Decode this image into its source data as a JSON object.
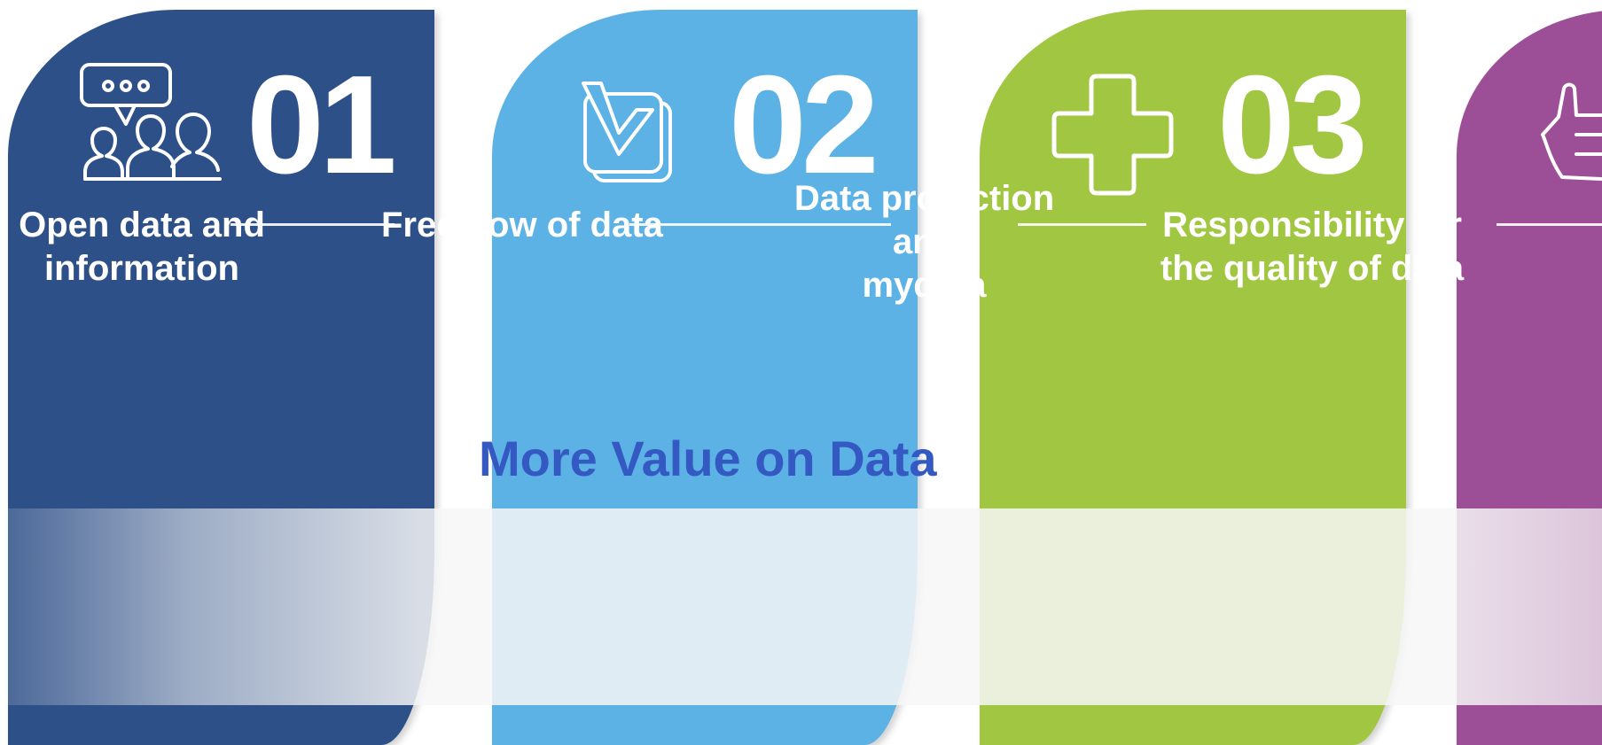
{
  "title": "More Value on Data",
  "cards": [
    {
      "number": "01",
      "label_lines": [
        "Open data and",
        "information"
      ],
      "icon": "people-chat-icon",
      "color": "#2e5088"
    },
    {
      "number": "02",
      "label_lines": [
        "Free flow of data"
      ],
      "icon": "checkbox-icon",
      "color": "#5cb1e5"
    },
    {
      "number": "03",
      "label_lines": [
        "Data protection",
        "and",
        "mydata"
      ],
      "icon": "plus-cross-icon",
      "color": "#a1c641"
    },
    {
      "number": "",
      "label_lines": [
        "Responsibility for",
        "the quality of data"
      ],
      "icon": "thumbs-up-icon",
      "color": "#9c4f97"
    }
  ],
  "colors": {
    "title": "#3459c2",
    "text": "#ffffff"
  }
}
